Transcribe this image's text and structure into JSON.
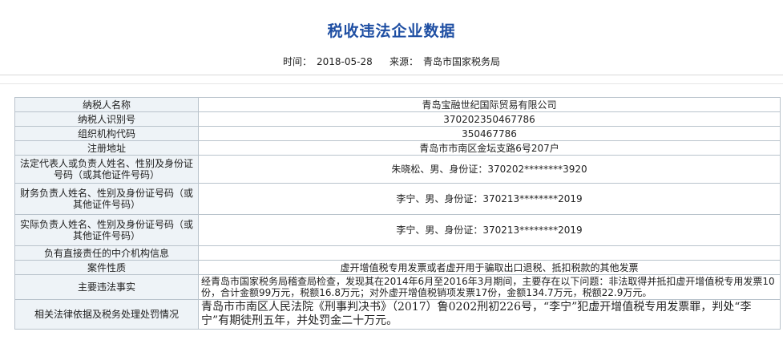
{
  "header": {
    "title": "税收违法企业数据",
    "time_label": "时间：",
    "time_value": "2018-05-28",
    "source_label": "来源：",
    "source_value": "青岛市国家税务局"
  },
  "rows": [
    {
      "key": "纳税人名称",
      "value": "青岛宝融世纪国际贸易有限公司"
    },
    {
      "key": "纳税人识别号",
      "value": "370202350467786"
    },
    {
      "key": "组织机构代码",
      "value": "350467786"
    },
    {
      "key": "注册地址",
      "value": "青岛市市南区金坛支路6号207户"
    },
    {
      "key": "法定代表人或负责人姓名、性别及身份证号码（或其他证件号码）",
      "value": "朱晓松、男、身份证：370202********3920"
    },
    {
      "key": "财务负责人姓名、性别及身份证号码（或其他证件号码）",
      "value": "李宁、男、身份证：370213********2019"
    },
    {
      "key": "实际负责人姓名、性别及身份证号码（或其他证件号码）",
      "value": "李宁、男、身份证：370213********2019"
    },
    {
      "key": "负有直接责任的中介机构信息",
      "value": ""
    },
    {
      "key": "案件性质",
      "value": "虚开增值税专用发票或者虚开用于骗取出口退税、抵扣税款的其他发票"
    },
    {
      "key": "主要违法事实",
      "value": "经青岛市国家税务局稽查局检查，发现其在2014年6月至2016年3月期间，主要存在以下问题：非法取得并抵扣虚开增值税专用发票10份，合计金额99万元，税额16.8万元；对外虚开增值税销项发票17份，金额134.7万元，税额22.9万元。"
    },
    {
      "key": "相关法律依据及税务处理处罚情况",
      "value": "青岛市市南区人民法院《刑事判决书》（2017）鲁0202刑初226号，“李宁”犯虚开增值税专用发票罪，判处“李宁”有期徒刑五年，并处罚金二十万元。"
    }
  ]
}
